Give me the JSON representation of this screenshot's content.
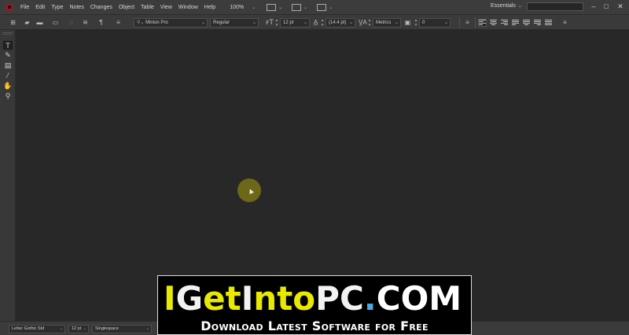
{
  "menubar": {
    "items": [
      "File",
      "Edit",
      "Type",
      "Notes",
      "Changes",
      "Object",
      "Table",
      "View",
      "Window",
      "Help"
    ],
    "zoom": "100%",
    "workspace": "Essentials"
  },
  "controlbar": {
    "font_family": "Minion Pro",
    "font_style": "Regular",
    "font_size": "12 pt",
    "leading": "(14.4 pt)",
    "kerning": "Metrics",
    "tracking": "0"
  },
  "tools": [
    "type-tool",
    "note-tool",
    "position-tool",
    "eyedropper-tool",
    "hand-tool",
    "zoom-tool"
  ],
  "statusbar": {
    "font": "Letter Gothic Std",
    "size": "12 pt",
    "spacing": "Singlespace"
  },
  "watermark": {
    "brand_parts": [
      {
        "text": "I",
        "color": "#e8e800"
      },
      {
        "text": "G",
        "color": "#f2f2f2"
      },
      {
        "text": "et",
        "color": "#e8e800"
      },
      {
        "text": "I",
        "color": "#f2f2f2"
      },
      {
        "text": "nto",
        "color": "#e8e800"
      },
      {
        "text": "PC",
        "color": "#f2f2f2"
      },
      {
        "text": ".",
        "color": "#4aa8e8"
      },
      {
        "text": "COM",
        "color": "#ffffff"
      }
    ],
    "tagline": "Download Latest Software for Free"
  },
  "colors": {
    "canvas": "#282828",
    "menubar": "#3c3c3c",
    "cursor_highlight": "#78731a"
  }
}
